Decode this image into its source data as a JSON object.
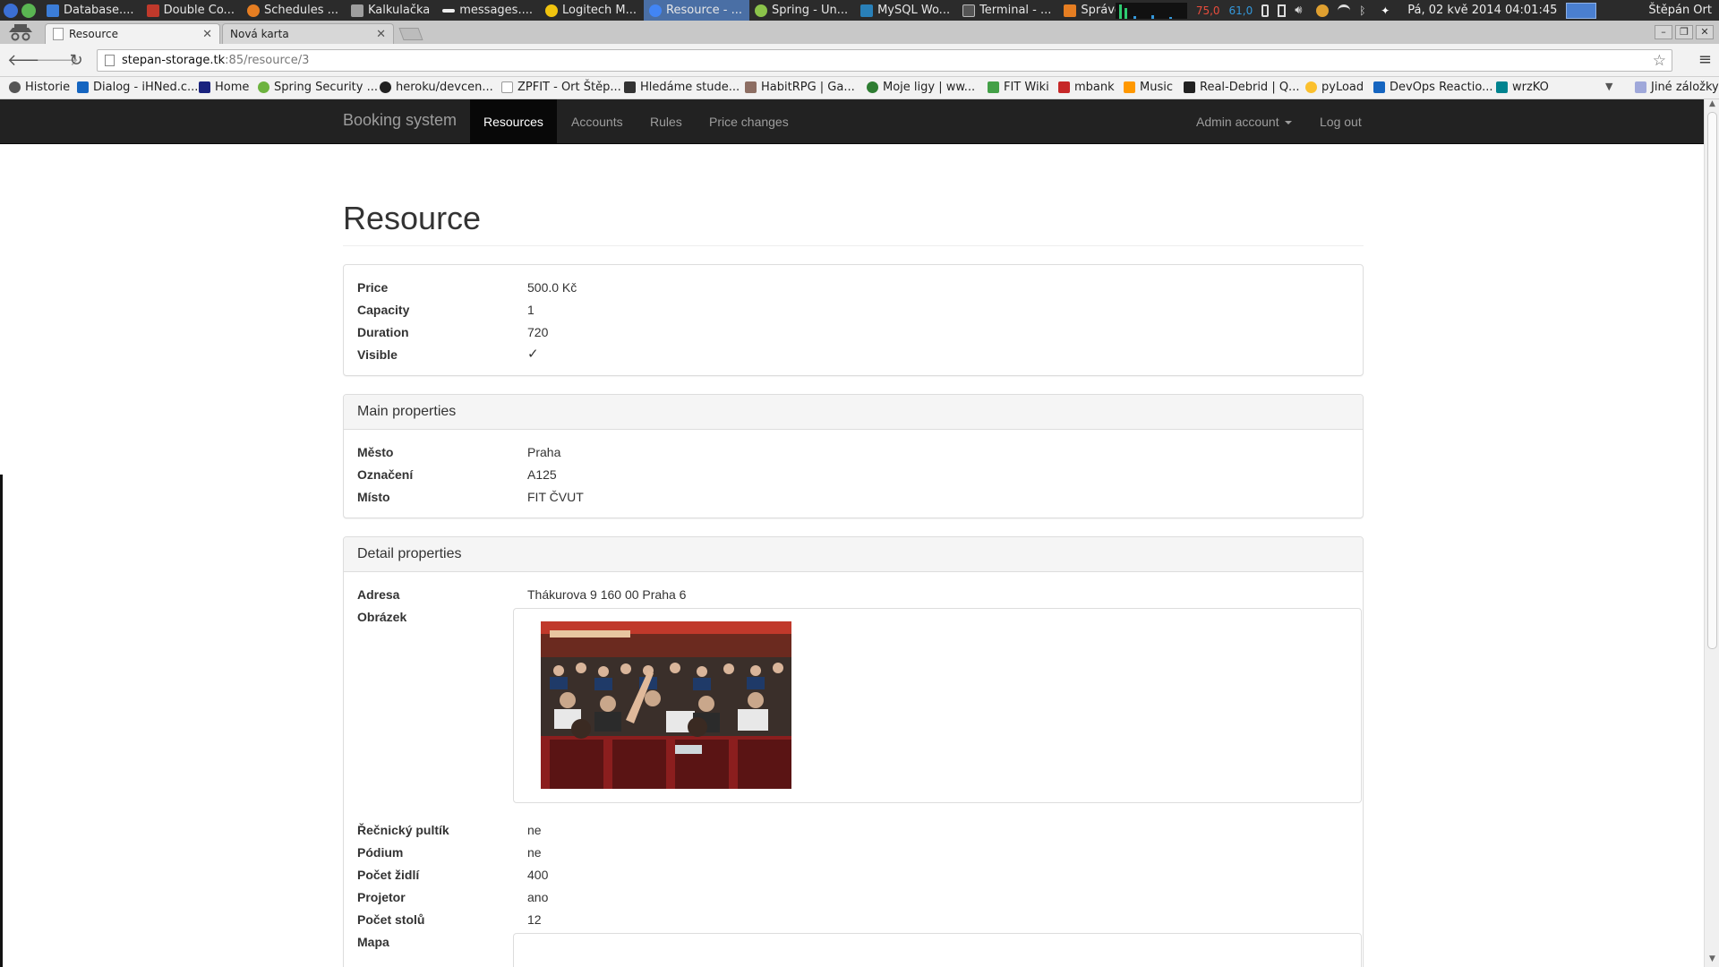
{
  "os": {
    "tasks": [
      {
        "label": "Database....",
        "color": "#3b7dd8"
      },
      {
        "label": "Double Co...",
        "color": "#c0392b"
      },
      {
        "label": "Schedules ...",
        "color": "#e67e22"
      },
      {
        "label": "Kalkulačka",
        "color": "#9e9e9e"
      },
      {
        "label": "messages....",
        "color": "#eeeeee"
      },
      {
        "label": "Logitech M...",
        "color": "#f1c40f"
      },
      {
        "label": "Resource - ...",
        "color": "#4285f4"
      },
      {
        "label": "Spring - Un...",
        "color": "#8bc34a"
      },
      {
        "label": "MySQL Wo...",
        "color": "#2980b9"
      },
      {
        "label": "Terminal - ...",
        "color": "#555555"
      },
      {
        "label": "Správce ak...",
        "color": "#e67e22"
      }
    ],
    "cpu_a": "75,0",
    "cpu_b": "61,0",
    "datetime": "Pá, 02 kvě 2014 04:01:45",
    "user": "Štěpán Ort"
  },
  "browser": {
    "tabs": [
      {
        "label": "Resource",
        "active": true
      },
      {
        "label": "Nová karta",
        "active": false
      }
    ],
    "url_host": "stepan-storage.tk",
    "url_path": ":85/resource/3",
    "bookmarks": [
      {
        "label": "Historie",
        "color": "#555555"
      },
      {
        "label": "Dialog - iHNed.c...",
        "color": "#1565c0"
      },
      {
        "label": "Home",
        "color": "#1a237e"
      },
      {
        "label": "Spring Security ...",
        "color": "#6db33f"
      },
      {
        "label": "heroku/devcen...",
        "color": "#222222"
      },
      {
        "label": "ZPFIT - Ort Štěp...",
        "color": "#9e9e9e"
      },
      {
        "label": "Hledáme stude...",
        "color": "#333333"
      },
      {
        "label": "HabitRPG | Ga...",
        "color": "#8d6e63"
      },
      {
        "label": "Moje ligy | ww...",
        "color": "#2e7d32"
      },
      {
        "label": "FIT Wiki",
        "color": "#43a047"
      },
      {
        "label": "mbank",
        "color": "#c62828"
      },
      {
        "label": "Music",
        "color": "#ff9800"
      },
      {
        "label": "Real-Debrid | Q...",
        "color": "#212121"
      },
      {
        "label": "pyLoad",
        "color": "#fbc02d"
      },
      {
        "label": "DevOps Reactio...",
        "color": "#1565c0"
      },
      {
        "label": "wrzKO",
        "color": "#00838f"
      }
    ],
    "other_bookmarks": "Jiné záložky"
  },
  "navbar": {
    "brand": "Booking system",
    "links": [
      "Resources",
      "Accounts",
      "Rules",
      "Price changes"
    ],
    "account": "Admin account",
    "logout": "Log out"
  },
  "page": {
    "title": "Resource",
    "basic": [
      {
        "label": "Price",
        "value": "500.0 Kč"
      },
      {
        "label": "Capacity",
        "value": "1"
      },
      {
        "label": "Duration",
        "value": "720"
      },
      {
        "label": "Visible",
        "value": "✓"
      }
    ],
    "main": {
      "heading": "Main properties",
      "rows": [
        {
          "label": "Město",
          "value": "Praha"
        },
        {
          "label": "Označení",
          "value": "A125"
        },
        {
          "label": "Místo",
          "value": "FIT ČVUT"
        }
      ]
    },
    "detail": {
      "heading": "Detail properties",
      "address_label": "Adresa",
      "address_value": "Thákurova 9 160 00 Praha 6",
      "image_label": "Obrázek",
      "rows": [
        {
          "label": "Řečnický pultík",
          "value": "ne"
        },
        {
          "label": "Pódium",
          "value": "ne"
        },
        {
          "label": "Počet židlí",
          "value": "400"
        },
        {
          "label": "Projetor",
          "value": "ano"
        },
        {
          "label": "Počet stolů",
          "value": "12"
        }
      ],
      "map_label": "Mapa"
    }
  }
}
